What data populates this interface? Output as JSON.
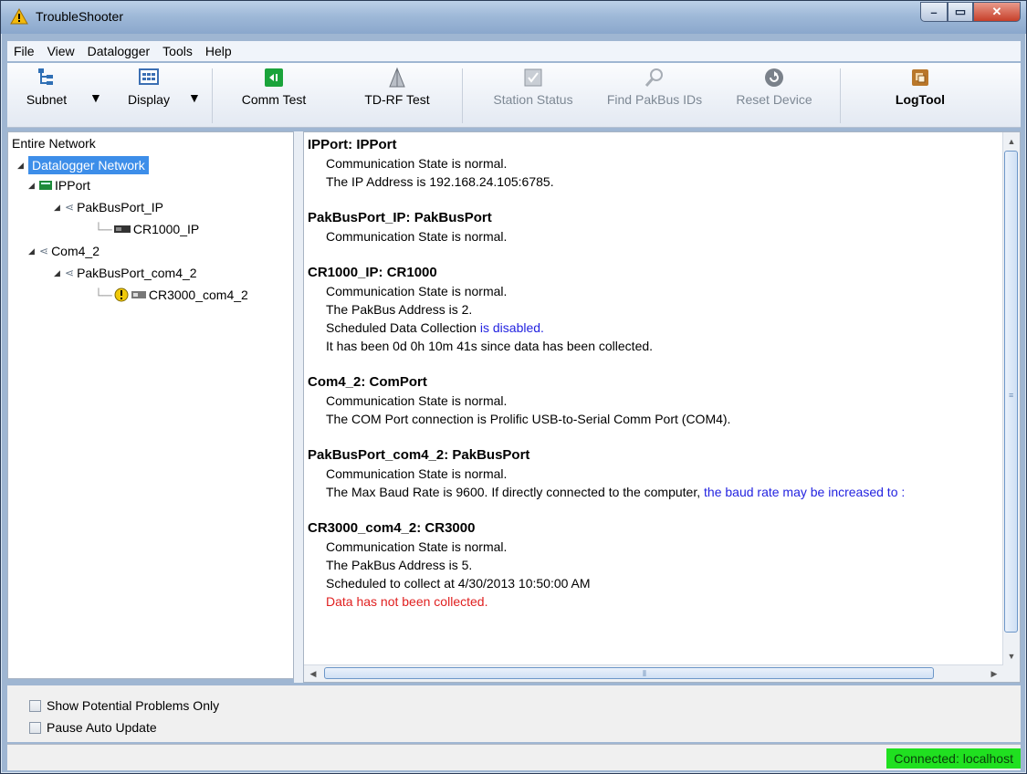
{
  "window": {
    "title": "TroubleShooter"
  },
  "menu": [
    "File",
    "View",
    "Datalogger",
    "Tools",
    "Help"
  ],
  "toolbar": {
    "subnet": "Subnet",
    "display": "Display",
    "comm_test": "Comm Test",
    "tdrf_test": "TD-RF Test",
    "station_status": "Station Status",
    "find_pakbus": "Find PakBus IDs",
    "reset_device": "Reset Device",
    "logtool": "LogTool"
  },
  "tree": {
    "header": "Entire Network",
    "nodes": [
      "Datalogger Network",
      "IPPort",
      "PakBusPort_IP",
      "CR1000_IP",
      "Com4_2",
      "PakBusPort_com4_2",
      "CR3000_com4_2"
    ]
  },
  "details": [
    {
      "title": "IPPort: IPPort",
      "lines": [
        "Communication State is normal.",
        "The IP Address is 192.168.24.105:6785."
      ]
    },
    {
      "title": "PakBusPort_IP: PakBusPort",
      "lines": [
        "Communication State is normal."
      ]
    },
    {
      "title": "CR1000_IP: CR1000",
      "lines": [
        "Communication State is normal.",
        "The PakBus Address is 2.",
        "Scheduled Data Collection",
        "is disabled.",
        "It has been 0d 0h 10m 41s since data has been collected."
      ]
    },
    {
      "title": "Com4_2: ComPort",
      "lines": [
        "Communication State is normal.",
        "The COM Port connection is Prolific USB-to-Serial Comm Port (COM4)."
      ]
    },
    {
      "title": "PakBusPort_com4_2: PakBusPort",
      "lines": [
        "Communication State is normal.",
        "The Max Baud Rate is 9600. If directly connected to the computer,",
        "the baud rate may be increased to :"
      ]
    },
    {
      "title": "CR3000_com4_2: CR3000",
      "lines": [
        "Communication State is normal.",
        "The PakBus Address is 5.",
        "Scheduled to collect at 4/30/2013 10:50:00 AM",
        "Data has not been collected."
      ]
    }
  ],
  "options": {
    "show_problems": "Show Potential Problems Only",
    "pause_update": "Pause Auto Update"
  },
  "status": {
    "connection": "Connected: localhost"
  },
  "colors": {
    "link": "#2323e0",
    "error": "#e02020",
    "connected": "#20e020",
    "selection": "#3d8ee9"
  }
}
